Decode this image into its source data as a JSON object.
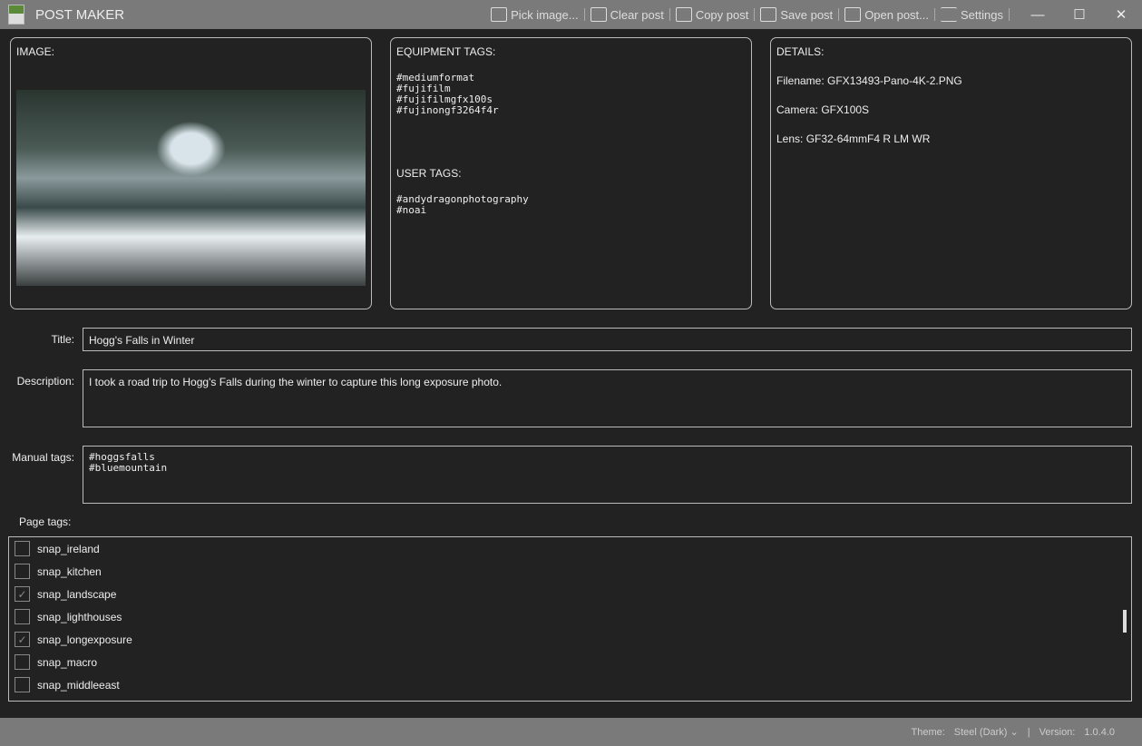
{
  "window": {
    "title": "POST MAKER"
  },
  "toolbar": {
    "pick": "Pick image...",
    "clear": "Clear post",
    "copy": "Copy post",
    "save": "Save post",
    "open": "Open post...",
    "settings": "Settings",
    "minimize": "—",
    "maximize": "☐",
    "close": "✕"
  },
  "image_panel": {
    "heading": "IMAGE:"
  },
  "equipment_panel": {
    "heading": "EQUIPMENT TAGS:",
    "tags": "#mediumformat\n#fujifilm\n#fujifilmgfx100s\n#fujinongf3264f4r",
    "user_heading": "USER TAGS:",
    "user_tags": "#andydragonphotography\n#noai"
  },
  "details_panel": {
    "heading": "DETAILS:",
    "filename": "Filename: GFX13493-Pano-4K-2.PNG",
    "camera": "Camera: GFX100S",
    "lens": "Lens: GF32-64mmF4 R LM WR"
  },
  "form": {
    "title_label": "Title:",
    "title_value": "Hogg's Falls in Winter",
    "description_label": "Description:",
    "description_value": "I took a road trip to Hogg's Falls during the winter to capture this long exposure photo.",
    "manual_label": "Manual tags:",
    "manual_value": "#hoggsfalls\n#bluemountain",
    "page_tags_label": "Page tags:"
  },
  "page_tags": [
    {
      "label": "snap_ireland",
      "checked": false
    },
    {
      "label": "snap_kitchen",
      "checked": false
    },
    {
      "label": "snap_landscape",
      "checked": true
    },
    {
      "label": "snap_lighthouses",
      "checked": false
    },
    {
      "label": "snap_longexposure",
      "checked": true
    },
    {
      "label": "snap_macro",
      "checked": false
    },
    {
      "label": "snap_middleeast",
      "checked": false
    }
  ],
  "status": {
    "theme_label": "Theme:",
    "theme_value": "Steel (Dark)",
    "separator": "|",
    "version_label": "Version:",
    "version_value": "1.0.4.0"
  }
}
